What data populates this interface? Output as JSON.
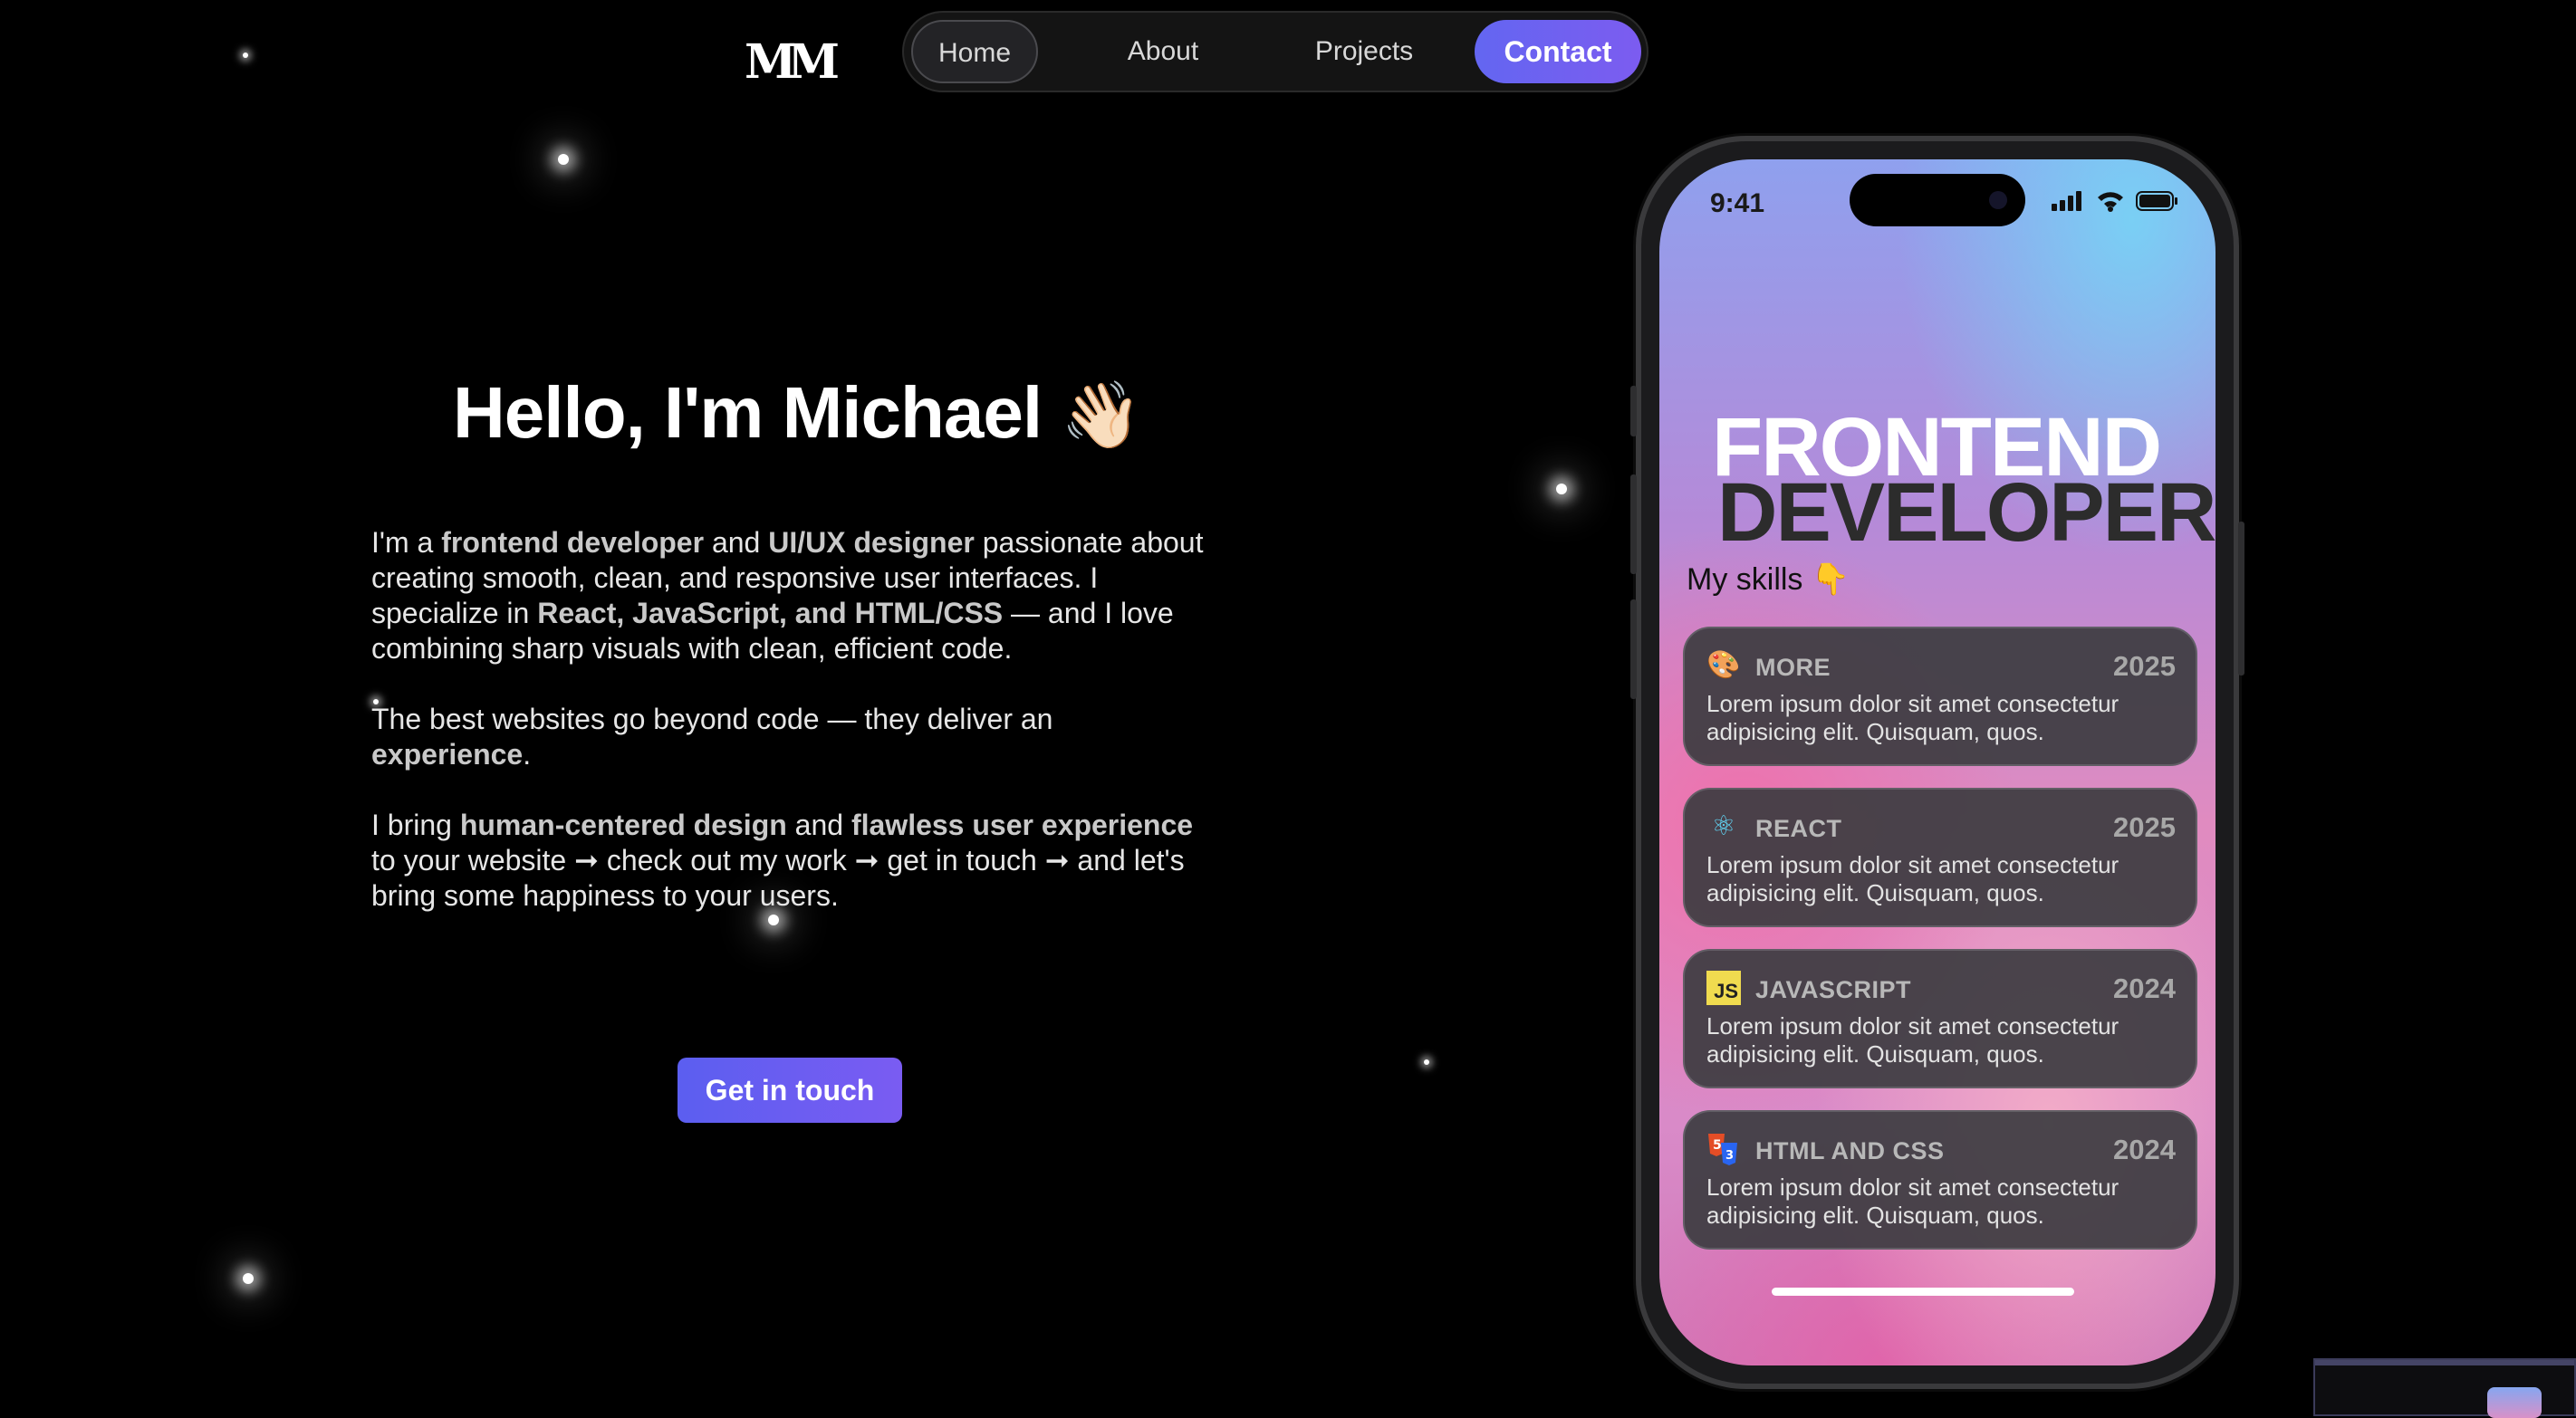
{
  "logo": {
    "text": "MM"
  },
  "nav": {
    "items": [
      {
        "label": "Home",
        "active": true
      },
      {
        "label": "About",
        "active": false
      },
      {
        "label": "Projects",
        "active": false
      },
      {
        "label": "Contact",
        "active": false,
        "accent": "#6366f1"
      }
    ]
  },
  "hero": {
    "title": "Hello, I'm Michael",
    "title_emoji": "👋🏻",
    "p1": [
      {
        "text": "I'm a "
      },
      {
        "text": "frontend developer",
        "bold": true
      },
      {
        "text": " and "
      },
      {
        "text": "UI/UX designer",
        "bold": true
      },
      {
        "text": " passionate about creating smooth, clean, and responsive user interfaces. I specialize in "
      },
      {
        "text": "React, JavaScript, and HTML/CSS",
        "bold": true
      },
      {
        "text": " — and I love combining sharp visuals with clean, efficient code."
      }
    ],
    "p2": [
      {
        "text": "The best websites go beyond code — they deliver an "
      },
      {
        "text": "experience",
        "bold": true
      },
      {
        "text": "."
      }
    ],
    "p3": [
      {
        "text": "I bring "
      },
      {
        "text": "human-centered design",
        "bold": true
      },
      {
        "text": " and "
      },
      {
        "text": "flawless user experience",
        "bold": true
      },
      {
        "text": " to your website ➞ check out my work ➞ get in touch ➞ and let's bring some happiness to your users."
      }
    ],
    "cta_label": "Get in touch",
    "cta_color": "#5b5ef0"
  },
  "phone": {
    "time": "9:41",
    "title_line1": "FRONTEND",
    "title_line2": "DEVELOPER",
    "skills_label": "My skills 👇",
    "skills": [
      {
        "icon": "palette-icon",
        "glyph": "🎨",
        "name": "MORE",
        "year": "2025",
        "desc": "Lorem ipsum dolor sit amet consectetur adipisicing elit. Quisquam, quos."
      },
      {
        "icon": "react-icon",
        "glyph": "⚛",
        "name": "REACT",
        "year": "2025",
        "desc": "Lorem ipsum dolor sit amet consectetur adipisicing elit. Quisquam, quos."
      },
      {
        "icon": "javascript-icon",
        "glyph": "JS",
        "name": "JAVASCRIPT",
        "year": "2024",
        "desc": "Lorem ipsum dolor sit amet consectetur adipisicing elit. Quisquam, quos."
      },
      {
        "icon": "html-css-icon",
        "glyph": "5",
        "name": "HTML AND CSS",
        "year": "2024",
        "desc": "Lorem ipsum dolor sit amet consectetur adipisicing elit. Quisquam, quos."
      }
    ]
  }
}
